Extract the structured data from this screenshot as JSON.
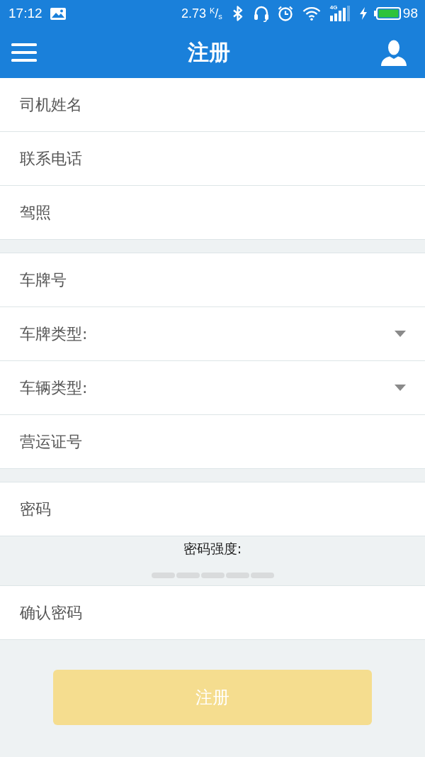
{
  "status_bar": {
    "time": "17:12",
    "network_speed": "2.73 $^{K}$/$_{s}$",
    "network_type": "4G",
    "battery": "98"
  },
  "app_bar": {
    "title": "注册"
  },
  "form": {
    "groups": [
      {
        "items": [
          {
            "kind": "input",
            "placeholder": "司机姓名"
          },
          {
            "kind": "input",
            "placeholder": "联系电话"
          },
          {
            "kind": "input",
            "placeholder": "驾照"
          }
        ]
      },
      {
        "items": [
          {
            "kind": "input",
            "placeholder": "车牌号"
          },
          {
            "kind": "select",
            "label": "车牌类型:"
          },
          {
            "kind": "select",
            "label": "车辆类型:"
          },
          {
            "kind": "input",
            "placeholder": "营运证号"
          }
        ]
      },
      {
        "items": [
          {
            "kind": "input",
            "placeholder": "密码"
          },
          {
            "kind": "strength",
            "label": "密码强度:",
            "segments": [
              {
                "lit": false
              },
              {
                "lit": false
              },
              {
                "lit": false
              },
              {
                "lit": false
              },
              {
                "lit": false
              }
            ]
          },
          {
            "kind": "input",
            "placeholder": "确认密码"
          }
        ]
      }
    ]
  },
  "submit_button": {
    "label": "注册",
    "disabled": true
  }
}
